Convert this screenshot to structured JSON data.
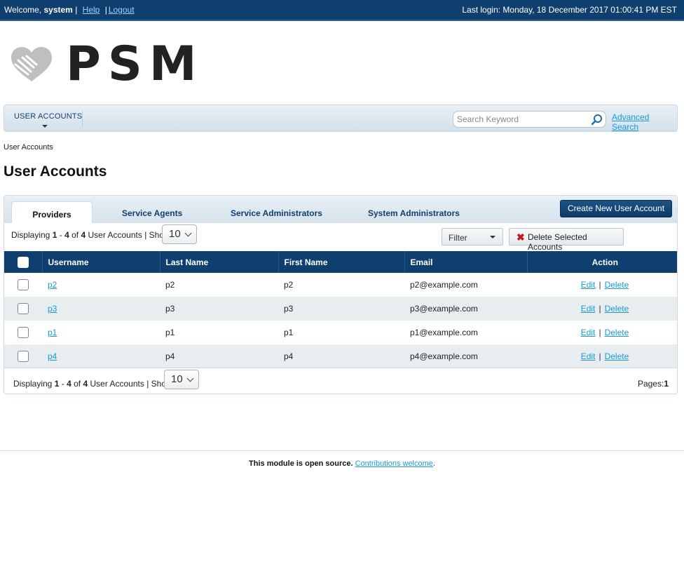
{
  "topbar": {
    "welcome_prefix": "Welcome,",
    "username": "system",
    "separator": "|",
    "help_label": "Help",
    "logout_label": "Logout",
    "last_login": "Last login: Monday, 18 December 2017 01:00:41 PM EST"
  },
  "logo": {
    "wordmark": "PSM"
  },
  "nav": {
    "menu_label": "USER ACCOUNTS",
    "search_placeholder": "Search Keyword",
    "advanced_search_label": "Advanced Search"
  },
  "breadcrumb": "User Accounts",
  "page_title": "User Accounts",
  "tabs": [
    {
      "label": "Providers",
      "active": true
    },
    {
      "label": "Service Agents",
      "active": false
    },
    {
      "label": "Service Administrators",
      "active": false
    },
    {
      "label": "System Administrators",
      "active": false
    }
  ],
  "create_button_label": "Create New User Account",
  "pagination": {
    "displaying": "Displaying",
    "from": "1",
    "dash": "-",
    "to": "4",
    "of": "of",
    "total": "4",
    "suffix": "User Accounts | Show:",
    "page_size": "10",
    "pages_label": "Pages:",
    "current_page": "1"
  },
  "filter_label": "Filter",
  "delete_selected_label": "Delete Selected Accounts",
  "table": {
    "columns": [
      "Username",
      "Last Name",
      "First Name",
      "Email",
      "Action"
    ],
    "rows": [
      {
        "username": "p2",
        "last_name": "p2",
        "first_name": "p2",
        "email": "p2@example.com"
      },
      {
        "username": "p3",
        "last_name": "p3",
        "first_name": "p3",
        "email": "p3@example.com"
      },
      {
        "username": "p1",
        "last_name": "p1",
        "first_name": "p1",
        "email": "p1@example.com"
      },
      {
        "username": "p4",
        "last_name": "p4",
        "first_name": "p4",
        "email": "p4@example.com"
      }
    ],
    "edit_label": "Edit",
    "action_separator": "|",
    "delete_label": "Delete"
  },
  "footer": {
    "text": "This module is open source.",
    "link_label": "Contributions welcome",
    "period": "."
  },
  "colors": {
    "header_navy": "#0f3f6e",
    "link_blue": "#1a9ad6",
    "delete_red": "#c8161d"
  }
}
